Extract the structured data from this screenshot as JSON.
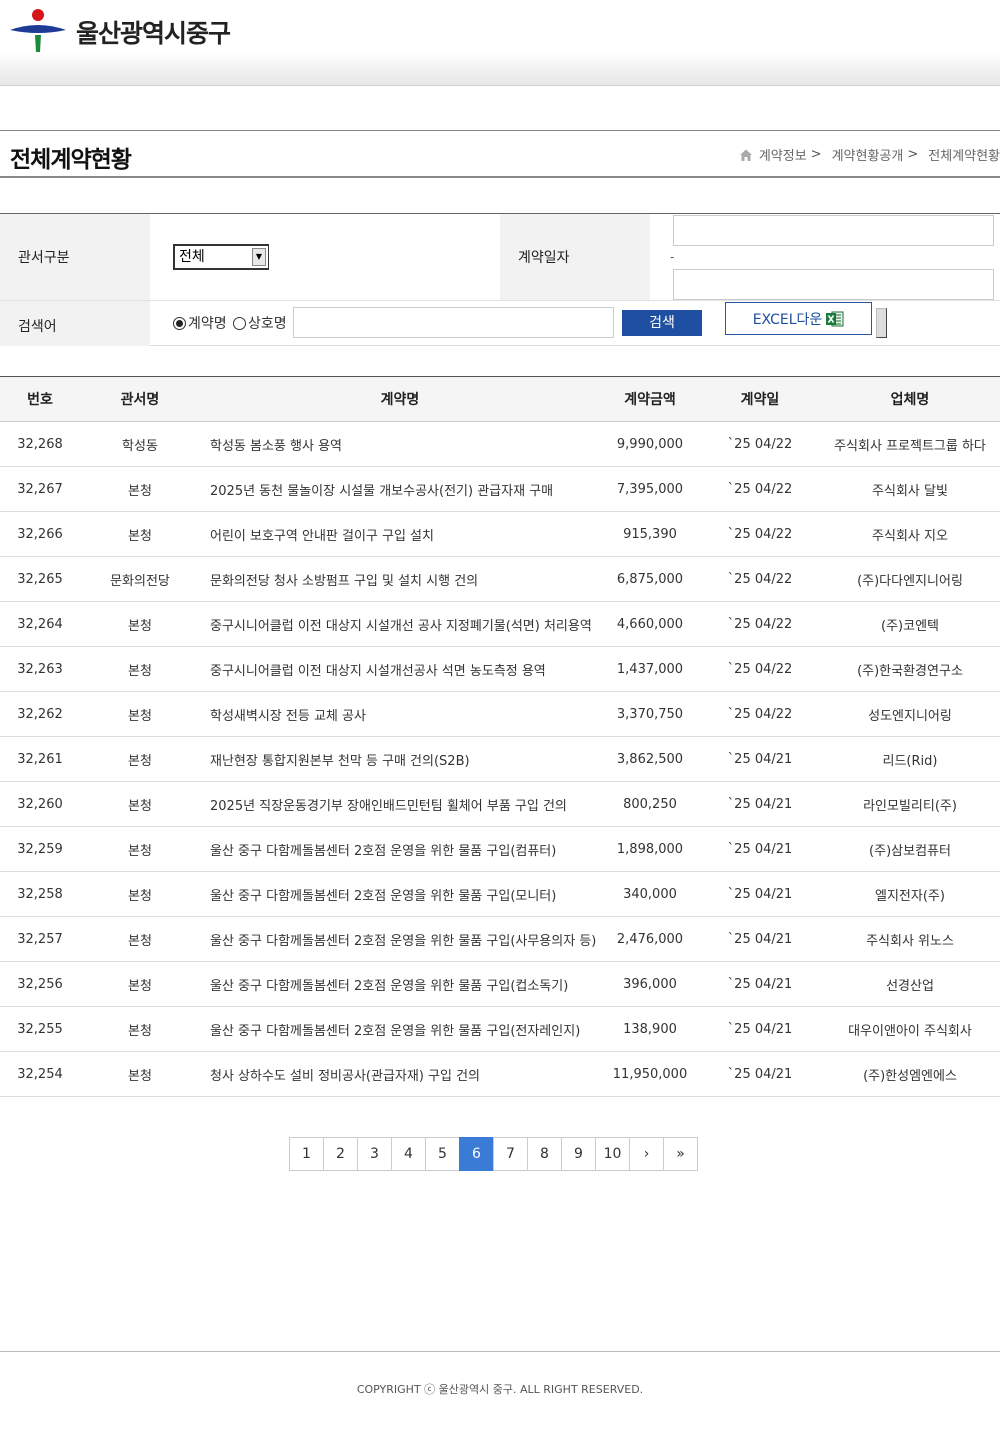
{
  "header": {
    "logo_text": "울산광역시중구"
  },
  "title": {
    "page_title": "전체계약현황",
    "breadcrumb": [
      "계약정보",
      "계약현황공개",
      "전체계약현황"
    ],
    "sep": ">"
  },
  "search": {
    "dept_label": "관서구분",
    "dept_value": "전체",
    "date_label": "계약일자",
    "date_sep": "-",
    "keyword_label": "검색어",
    "radio_contract": "계약명",
    "radio_company": "상호명",
    "search_button": "검색",
    "excel_button": "EXCEL다운"
  },
  "table": {
    "headers": [
      "번호",
      "관서명",
      "계약명",
      "계약금액",
      "계약일",
      "업체명"
    ],
    "rows": [
      [
        "32,268",
        "학성동",
        "학성동 봄소풍 행사 용역",
        "9,990,000",
        "`25 04/22",
        "주식회사 프로젝트그룹 하다"
      ],
      [
        "32,267",
        "본청",
        "2025년 동천 물놀이장 시설물 개보수공사(전기) 관급자재 구매",
        "7,395,000",
        "`25 04/22",
        "주식회사 달빛"
      ],
      [
        "32,266",
        "본청",
        "어린이 보호구역 안내판 걸이구 구입 설치",
        "915,390",
        "`25 04/22",
        "주식회사 지오"
      ],
      [
        "32,265",
        "문화의전당",
        "문화의전당 청사 소방펌프 구입 및 설치 시행 건의",
        "6,875,000",
        "`25 04/22",
        "(주)다다엔지니어링"
      ],
      [
        "32,264",
        "본청",
        "중구시니어클럽 이전 대상지 시설개선 공사 지정폐기물(석면) 처리용역",
        "4,660,000",
        "`25 04/22",
        "(주)코엔텍"
      ],
      [
        "32,263",
        "본청",
        "중구시니어클럽 이전 대상지 시설개선공사 석면 농도측정 용역",
        "1,437,000",
        "`25 04/22",
        "(주)한국환경연구소"
      ],
      [
        "32,262",
        "본청",
        "학성새벽시장 전등 교체 공사",
        "3,370,750",
        "`25 04/22",
        "성도엔지니어링"
      ],
      [
        "32,261",
        "본청",
        "재난현장 통합지원본부 천막 등 구매 건의(S2B)",
        "3,862,500",
        "`25 04/21",
        "리드(Rid)"
      ],
      [
        "32,260",
        "본청",
        "2025년 직장운동경기부 장애인배드민턴팀 휠체어 부품 구입 건의",
        "800,250",
        "`25 04/21",
        "라인모빌리티(주)"
      ],
      [
        "32,259",
        "본청",
        "울산 중구 다함께돌봄센터 2호점 운영을 위한 물품 구입(컴퓨터)",
        "1,898,000",
        "`25 04/21",
        "(주)삼보컴퓨터"
      ],
      [
        "32,258",
        "본청",
        "울산 중구 다함께돌봄센터 2호점 운영을 위한 물품 구입(모니터)",
        "340,000",
        "`25 04/21",
        "엘지전자(주)"
      ],
      [
        "32,257",
        "본청",
        "울산 중구 다함께돌봄센터 2호점 운영을 위한 물품 구입(사무용의자 등)",
        "2,476,000",
        "`25 04/21",
        "주식회사 위노스"
      ],
      [
        "32,256",
        "본청",
        "울산 중구 다함께돌봄센터 2호점 운영을 위한 물품 구입(컵소독기)",
        "396,000",
        "`25 04/21",
        "선경산업"
      ],
      [
        "32,255",
        "본청",
        "울산 중구 다함께돌봄센터 2호점 운영을 위한 물품 구입(전자레인지)",
        "138,900",
        "`25 04/21",
        "대우이앤아이 주식회사"
      ],
      [
        "32,254",
        "본청",
        "청사 상하수도 설비 정비공사(관급자재) 구입 건의",
        "11,950,000",
        "`25 04/21",
        "(주)한성엠엔에스"
      ]
    ]
  },
  "pagination": {
    "pages": [
      "1",
      "2",
      "3",
      "4",
      "5",
      "6",
      "7",
      "8",
      "9",
      "10"
    ],
    "current": "6",
    "next": "›",
    "last": "»"
  },
  "footer": {
    "copyright": "COPYRIGHT ⓒ 울산광역시 중구. ALL RIGHT RESERVED."
  },
  "colors": {
    "primary_button": "#1f4fa0",
    "active_page": "#3a7bd5",
    "logo_red": "#d7141a",
    "logo_blue": "#1e3c96",
    "logo_green": "#1b8a3a"
  },
  "icons": {
    "home": "home-icon",
    "excel": "excel-icon",
    "logo": "ulsan-junggu-logo"
  }
}
